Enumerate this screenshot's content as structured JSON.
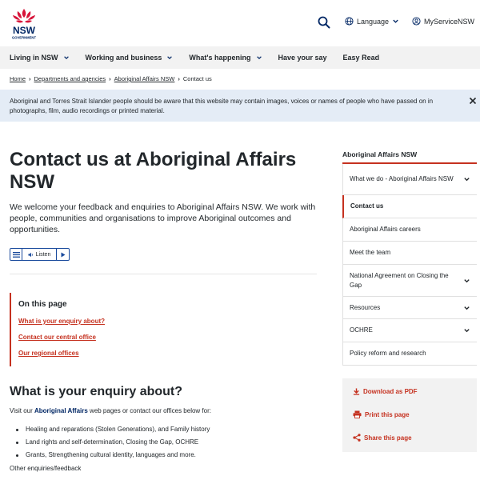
{
  "header": {
    "logo_text": "NSW",
    "logo_subtext": "GOVERNMENT",
    "language_label": "Language",
    "myservice_label": "MyServiceNSW"
  },
  "nav": {
    "items": [
      {
        "label": "Living in NSW",
        "has_dropdown": true
      },
      {
        "label": "Working and business",
        "has_dropdown": true
      },
      {
        "label": "What's happening",
        "has_dropdown": true
      },
      {
        "label": "Have your say",
        "has_dropdown": false
      },
      {
        "label": "Easy Read",
        "has_dropdown": false
      }
    ]
  },
  "breadcrumb": {
    "items": [
      "Home",
      "Departments and agencies",
      "Aboriginal Affairs NSW",
      "Contact us"
    ]
  },
  "banner": {
    "text": "Aboriginal and Torres Strait Islander people should be aware that this website may contain images, voices or names of people who have passed on in photographs, film, audio recordings or printed material."
  },
  "main": {
    "title": "Contact us at Aboriginal Affairs NSW",
    "intro": "We welcome your feedback and enquiries to Aboriginal Affairs NSW. We work with people, communities and organisations to improve Aboriginal outcomes and opportunities.",
    "listen_label": "Listen",
    "on_this_page": {
      "title": "On this page",
      "links": [
        "What is your enquiry about?",
        "Contact our central office",
        "Our regional offices"
      ]
    },
    "section_heading": "What is your enquiry about?",
    "visit_prefix": "Visit our ",
    "visit_link": "Aboriginal Affairs",
    "visit_suffix": " web pages or contact our offices below for:",
    "bullets": [
      "Healing and reparations (Stolen Generations), and Family history",
      "Land rights and self-determination, Closing the Gap, OCHRE",
      "Grants, Strengthening cultural identity, languages and more."
    ],
    "other": "Other enquiries/feedback"
  },
  "sidebar": {
    "heading": "Aboriginal Affairs NSW",
    "items": [
      {
        "label": "What we do - Aboriginal Affairs NSW",
        "expandable": true,
        "active": false
      },
      {
        "label": "Contact us",
        "expandable": false,
        "active": true
      },
      {
        "label": "Aboriginal Affairs careers",
        "expandable": false,
        "active": false
      },
      {
        "label": "Meet the team",
        "expandable": false,
        "active": false
      },
      {
        "label": "National Agreement on Closing the Gap",
        "expandable": true,
        "active": false
      },
      {
        "label": "Resources",
        "expandable": true,
        "active": false
      },
      {
        "label": "OCHRE",
        "expandable": true,
        "active": false
      },
      {
        "label": "Policy reform and research",
        "expandable": false,
        "active": false
      }
    ]
  },
  "share": {
    "download_label": "Download as PDF",
    "print_label": "Print this page",
    "share_label": "Share this page"
  },
  "colors": {
    "accent_red": "#c5311f",
    "nsw_blue": "#002664",
    "banner_bg": "#e4ecf6",
    "nav_bg": "#f2f2f2"
  }
}
